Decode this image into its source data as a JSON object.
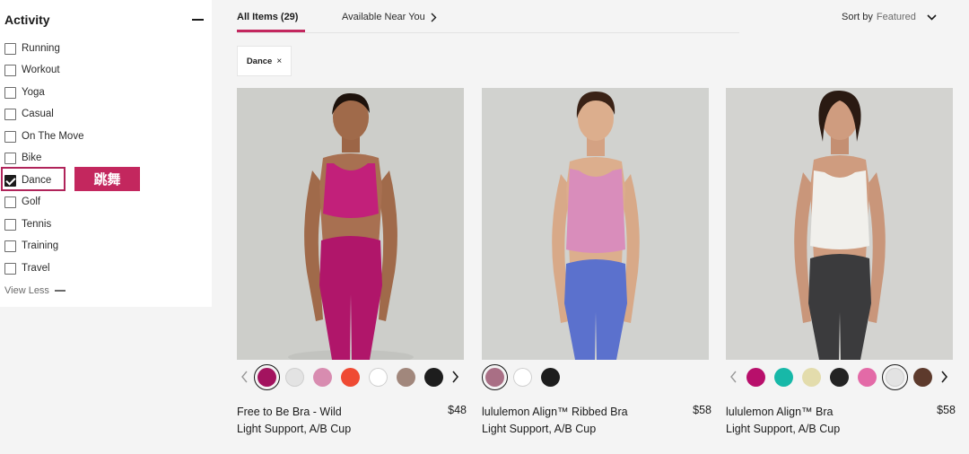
{
  "sidebar": {
    "title": "Activity",
    "options": [
      {
        "label": "Running",
        "checked": false
      },
      {
        "label": "Workout",
        "checked": false
      },
      {
        "label": "Yoga",
        "checked": false
      },
      {
        "label": "Casual",
        "checked": false
      },
      {
        "label": "On The Move",
        "checked": false
      },
      {
        "label": "Bike",
        "checked": false
      },
      {
        "label": "Dance",
        "checked": true
      },
      {
        "label": "Golf",
        "checked": false
      },
      {
        "label": "Tennis",
        "checked": false
      },
      {
        "label": "Training",
        "checked": false
      },
      {
        "label": "Travel",
        "checked": false
      }
    ],
    "view_less": "View Less",
    "annotation": "跳舞"
  },
  "tabs": {
    "all_items": "All Items (29)",
    "available": "Available Near You"
  },
  "sort": {
    "label": "Sort by",
    "value": "Featured"
  },
  "chip": {
    "label": "Dance",
    "remove": "×"
  },
  "products": [
    {
      "name_line1": "Free to Be Bra - Wild",
      "name_line2": "Light Support, A/B Cup",
      "price": "$48",
      "bra_color": "#c2207a",
      "bottom_color": "#b0166a",
      "swatches": [
        "#a3135f",
        "#e3e3e3",
        "#d88cb0",
        "#ef4a33",
        "#ffffff",
        "#a1877c",
        "#1d1d1d"
      ]
    },
    {
      "name_line1": "lululemon Align™ Ribbed Bra",
      "name_line2": "Light Support, A/B Cup",
      "price": "$58",
      "bra_color": "#d98dbb",
      "bottom_color": "#5b71cd",
      "swatches": [
        "#a96f85",
        "#ffffff",
        "#1d1d1d"
      ]
    },
    {
      "name_line1": "lululemon Align™ Bra",
      "name_line2": "Light Support, A/B Cup",
      "price": "$58",
      "bra_color": "#f1f0ec",
      "bottom_color": "#3b3b3d",
      "swatches": [
        "#b80f6b",
        "#17b8a8",
        "#e3dcac",
        "#242424",
        "#e36aa7",
        "#e3e3e3",
        "#5d3a2c"
      ]
    }
  ]
}
